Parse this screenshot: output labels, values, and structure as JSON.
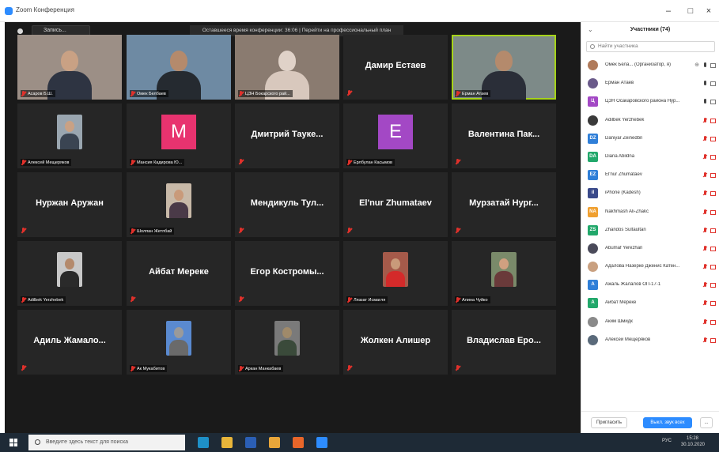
{
  "window": {
    "title": "Zoom Конференция",
    "minimize": "–",
    "maximize": "□",
    "close": "×"
  },
  "meeting_bar": {
    "view_button": "Запись...",
    "banner": "Оставшееся время конференции: 36:06 | Перейти на профессиональный план"
  },
  "tiles": [
    {
      "name": "Асаров Б.Ш.",
      "type": "video",
      "scene": "office"
    },
    {
      "name": "Омек Белбаев",
      "type": "video",
      "scene": "man"
    },
    {
      "name": "ЦЗН Бокарского рай...",
      "type": "video",
      "scene": "mask"
    },
    {
      "name": "Дамир Естаев",
      "type": "text"
    },
    {
      "name": "Ерман Атаев",
      "type": "video",
      "scene": "man2",
      "active": true
    },
    {
      "name": "Алексей Мещеряков",
      "type": "photo",
      "scene": "photo-man"
    },
    {
      "name": "Мансия Кадирова Ю...",
      "type": "letter",
      "letter": "M",
      "color": "#e8336f"
    },
    {
      "name": "Дмитрий Тауке...",
      "type": "text"
    },
    {
      "name": "Ерлбулан Касымов",
      "type": "letter",
      "letter": "E",
      "color": "#a348c5"
    },
    {
      "name": "Валентина Пак...",
      "type": "text"
    },
    {
      "name": "Нуржан Аружан",
      "type": "text"
    },
    {
      "name": "Шолпан Жетпбай",
      "type": "photo",
      "scene": "photo-woman"
    },
    {
      "name": "Мендикуль Тул...",
      "type": "text"
    },
    {
      "name": "El'nur Zhumataev",
      "type": "text"
    },
    {
      "name": "Мурзатай Нург...",
      "type": "text"
    },
    {
      "name": "Adilbek Yerzhebek",
      "type": "photo",
      "scene": "photo-man2"
    },
    {
      "name": "Айбат Мереке",
      "type": "text"
    },
    {
      "name": "Егор Костромы...",
      "type": "text"
    },
    {
      "name": "Ляззат Исмагля",
      "type": "photo",
      "scene": "photo-red"
    },
    {
      "name": "Алина Чуйко",
      "type": "photo",
      "scene": "photo-woman2"
    },
    {
      "name": "Адиль Жамало...",
      "type": "text"
    },
    {
      "name": "Ак Мукабитов",
      "type": "photo",
      "scene": "photo-sky"
    },
    {
      "name": "Аркан Манкабаев",
      "type": "photo",
      "scene": "photo-car"
    },
    {
      "name": "Жолкен Алишер",
      "type": "text"
    },
    {
      "name": "Владислав Еро...",
      "type": "text"
    }
  ],
  "panel": {
    "title": "Участники (74)",
    "collapse": "⌄",
    "search_placeholder": "Найти участника",
    "participants": [
      {
        "name": "Омек Бела... (Организатор, я)",
        "avatar": "photo",
        "color": "#b07a5a",
        "extra": "⊕",
        "mic_on": true,
        "cam_on": true
      },
      {
        "name": "Ерман Атаев",
        "avatar": "photo",
        "color": "#6a5a8a",
        "extra": "",
        "mic_on": true,
        "cam_on": true
      },
      {
        "name": "ЦЗН Осакаровского района Нур...",
        "avatar": "Ц",
        "color": "#a348c5",
        "extra": "",
        "mic_on": true,
        "cam_on": true
      },
      {
        "name": "Adilbek Yerzhebek",
        "avatar": "photo",
        "color": "#3a3a3a",
        "extra": "",
        "mic_on": false,
        "cam_on": false
      },
      {
        "name": "Daniyar Zeinedbn",
        "avatar": "DZ",
        "color": "#2f7fd8",
        "extra": "",
        "mic_on": false,
        "cam_on": false
      },
      {
        "name": "Diana Abildna",
        "avatar": "DA",
        "color": "#22a86b",
        "extra": "",
        "mic_on": false,
        "cam_on": false
      },
      {
        "name": "El'nur Zhumataev",
        "avatar": "EZ",
        "color": "#2f7fd8",
        "extra": "",
        "mic_on": false,
        "cam_on": false
      },
      {
        "name": "iPhone (Kadesh)",
        "avatar": "iI",
        "color": "#3a4a8a",
        "extra": "",
        "mic_on": false,
        "cam_on": false
      },
      {
        "name": "Nakhmash Ali-Zhakc",
        "avatar": "NA",
        "color": "#f0a030",
        "extra": "",
        "mic_on": false,
        "cam_on": false
      },
      {
        "name": "Zhandos Sultaultan",
        "avatar": "ZS",
        "color": "#22a86b",
        "extra": "",
        "mic_on": false,
        "cam_on": false
      },
      {
        "name": "Abumaf Yerezhan",
        "avatar": "photo",
        "color": "#4a4a5a",
        "extra": "",
        "mic_on": false,
        "cam_on": false
      },
      {
        "name": "Адалова Назерке Дженис Катен...",
        "avatar": "photo",
        "color": "#c9a080",
        "extra": "",
        "mic_on": false,
        "cam_on": false
      },
      {
        "name": "Ажаль Жалалов ОП-17-1",
        "avatar": "А",
        "color": "#2f7fd8",
        "extra": "",
        "mic_on": false,
        "cam_on": false
      },
      {
        "name": "Айбат Мереке",
        "avatar": "А",
        "color": "#22a86b",
        "extra": "",
        "mic_on": false,
        "cam_on": false
      },
      {
        "name": "Аким Шмидк",
        "avatar": "photo",
        "color": "#8a8a8a",
        "extra": "",
        "mic_on": false,
        "cam_on": false
      },
      {
        "name": "Алексей Мещеряков",
        "avatar": "photo",
        "color": "#5a6a7a",
        "extra": "",
        "mic_on": false,
        "cam_on": false
      }
    ],
    "invite_button": "Пригласить",
    "mute_all_button": "Выкл. звук всех",
    "more_button": "..."
  },
  "taskbar": {
    "search_placeholder": "Введите здесь текст для поиска",
    "time": "15:28",
    "date": "30.10.2020",
    "lang": "РУС",
    "apps": [
      {
        "name": "edge-icon",
        "color": "#1e90c8"
      },
      {
        "name": "explorer-icon",
        "color": "#e8b53a"
      },
      {
        "name": "word-icon",
        "color": "#2b5fb5"
      },
      {
        "name": "chrome-icon",
        "color": "#e8a63a"
      },
      {
        "name": "powerpoint-icon",
        "color": "#e8662a"
      },
      {
        "name": "zoom-icon",
        "color": "#2d8cff"
      }
    ]
  }
}
